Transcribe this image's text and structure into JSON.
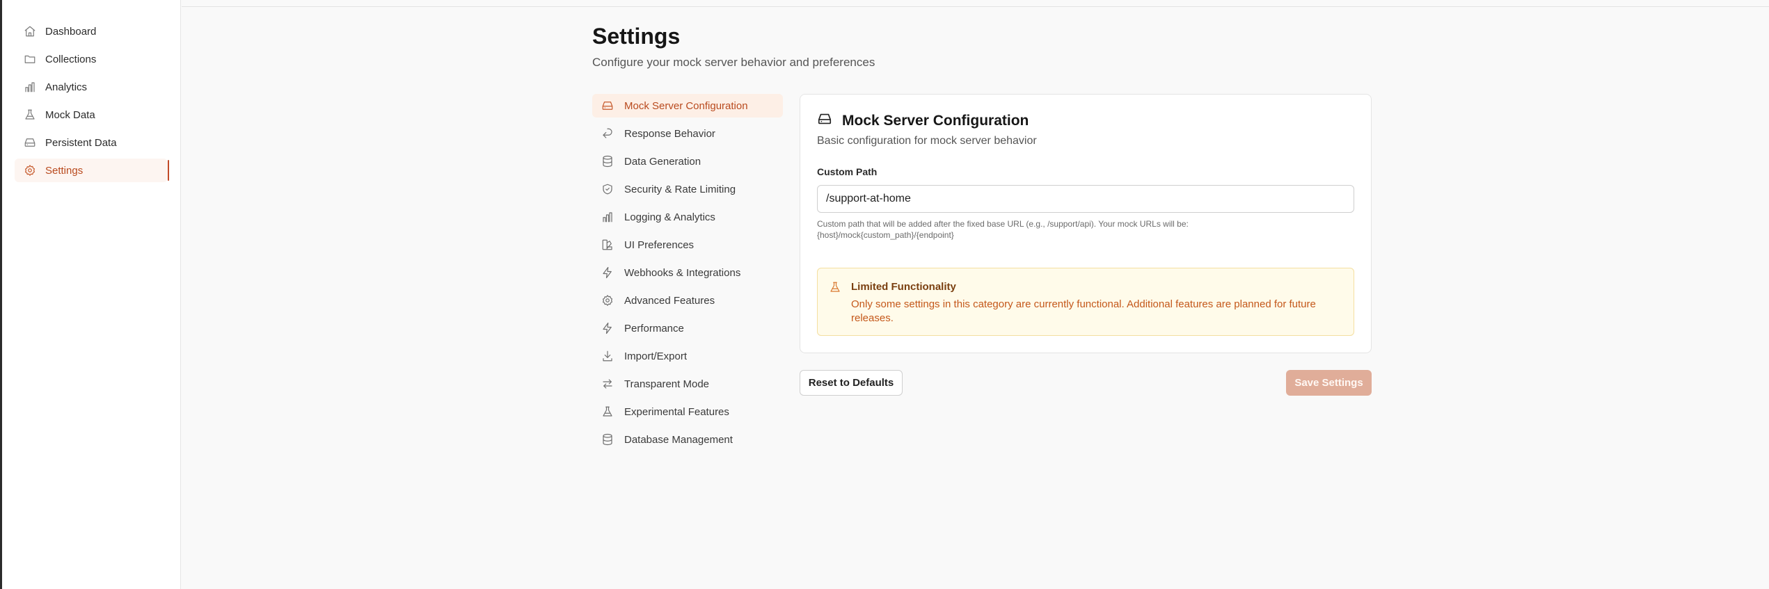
{
  "sidebar": {
    "items": [
      {
        "label": "Dashboard",
        "icon": "home-icon"
      },
      {
        "label": "Collections",
        "icon": "folder-icon"
      },
      {
        "label": "Analytics",
        "icon": "bar-chart-icon"
      },
      {
        "label": "Mock Data",
        "icon": "flask-icon"
      },
      {
        "label": "Persistent Data",
        "icon": "hard-drive-icon"
      },
      {
        "label": "Settings",
        "icon": "gear-icon",
        "active": true
      }
    ]
  },
  "header": {
    "title": "Settings",
    "subtitle": "Configure your mock server behavior and preferences"
  },
  "settings_menu": {
    "items": [
      {
        "label": "Mock Server Configuration",
        "icon": "hard-drive-icon",
        "active": true
      },
      {
        "label": "Response Behavior",
        "icon": "reply-icon"
      },
      {
        "label": "Data Generation",
        "icon": "database-icon"
      },
      {
        "label": "Security & Rate Limiting",
        "icon": "shield-check-icon"
      },
      {
        "label": "Logging & Analytics",
        "icon": "bar-chart-icon"
      },
      {
        "label": "UI Preferences",
        "icon": "palette-icon"
      },
      {
        "label": "Webhooks & Integrations",
        "icon": "zap-icon"
      },
      {
        "label": "Advanced Features",
        "icon": "gear-icon"
      },
      {
        "label": "Performance",
        "icon": "zap-icon"
      },
      {
        "label": "Import/Export",
        "icon": "download-icon"
      },
      {
        "label": "Transparent Mode",
        "icon": "arrows-exchange-icon"
      },
      {
        "label": "Experimental Features",
        "icon": "flask-icon"
      },
      {
        "label": "Database Management",
        "icon": "database-icon"
      }
    ]
  },
  "card": {
    "icon": "hard-drive-icon",
    "title": "Mock Server Configuration",
    "description": "Basic configuration for mock server behavior",
    "custom_path": {
      "label": "Custom Path",
      "value": "/support-at-home",
      "help": "Custom path that will be added after the fixed base URL (e.g., /support/api). Your mock URLs will be: {host}/mock{custom_path}/{endpoint}"
    },
    "alert": {
      "icon": "flask-icon",
      "title": "Limited Functionality",
      "body": "Only some settings in this category are currently functional. Additional features are planned for future releases."
    }
  },
  "actions": {
    "reset_label": "Reset to Defaults",
    "save_label": "Save Settings"
  },
  "colors": {
    "accent": "#c65a2c",
    "active_bg": "#fdefe6",
    "save_button": "#e0ad99",
    "alert_bg": "#fffbea"
  }
}
